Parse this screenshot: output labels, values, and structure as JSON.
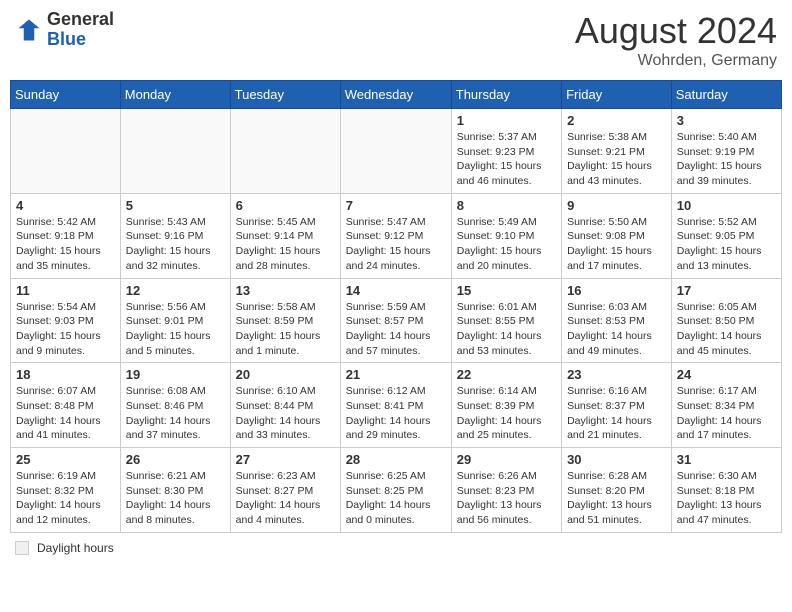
{
  "header": {
    "logo_general": "General",
    "logo_blue": "Blue",
    "month_year": "August 2024",
    "location": "Wohrden, Germany"
  },
  "days_of_week": [
    "Sunday",
    "Monday",
    "Tuesday",
    "Wednesday",
    "Thursday",
    "Friday",
    "Saturday"
  ],
  "legend": {
    "label": "Daylight hours"
  },
  "weeks": [
    [
      {
        "day": "",
        "info": ""
      },
      {
        "day": "",
        "info": ""
      },
      {
        "day": "",
        "info": ""
      },
      {
        "day": "",
        "info": ""
      },
      {
        "day": "1",
        "info": "Sunrise: 5:37 AM\nSunset: 9:23 PM\nDaylight: 15 hours\nand 46 minutes."
      },
      {
        "day": "2",
        "info": "Sunrise: 5:38 AM\nSunset: 9:21 PM\nDaylight: 15 hours\nand 43 minutes."
      },
      {
        "day": "3",
        "info": "Sunrise: 5:40 AM\nSunset: 9:19 PM\nDaylight: 15 hours\nand 39 minutes."
      }
    ],
    [
      {
        "day": "4",
        "info": "Sunrise: 5:42 AM\nSunset: 9:18 PM\nDaylight: 15 hours\nand 35 minutes."
      },
      {
        "day": "5",
        "info": "Sunrise: 5:43 AM\nSunset: 9:16 PM\nDaylight: 15 hours\nand 32 minutes."
      },
      {
        "day": "6",
        "info": "Sunrise: 5:45 AM\nSunset: 9:14 PM\nDaylight: 15 hours\nand 28 minutes."
      },
      {
        "day": "7",
        "info": "Sunrise: 5:47 AM\nSunset: 9:12 PM\nDaylight: 15 hours\nand 24 minutes."
      },
      {
        "day": "8",
        "info": "Sunrise: 5:49 AM\nSunset: 9:10 PM\nDaylight: 15 hours\nand 20 minutes."
      },
      {
        "day": "9",
        "info": "Sunrise: 5:50 AM\nSunset: 9:08 PM\nDaylight: 15 hours\nand 17 minutes."
      },
      {
        "day": "10",
        "info": "Sunrise: 5:52 AM\nSunset: 9:05 PM\nDaylight: 15 hours\nand 13 minutes."
      }
    ],
    [
      {
        "day": "11",
        "info": "Sunrise: 5:54 AM\nSunset: 9:03 PM\nDaylight: 15 hours\nand 9 minutes."
      },
      {
        "day": "12",
        "info": "Sunrise: 5:56 AM\nSunset: 9:01 PM\nDaylight: 15 hours\nand 5 minutes."
      },
      {
        "day": "13",
        "info": "Sunrise: 5:58 AM\nSunset: 8:59 PM\nDaylight: 15 hours\nand 1 minute."
      },
      {
        "day": "14",
        "info": "Sunrise: 5:59 AM\nSunset: 8:57 PM\nDaylight: 14 hours\nand 57 minutes."
      },
      {
        "day": "15",
        "info": "Sunrise: 6:01 AM\nSunset: 8:55 PM\nDaylight: 14 hours\nand 53 minutes."
      },
      {
        "day": "16",
        "info": "Sunrise: 6:03 AM\nSunset: 8:53 PM\nDaylight: 14 hours\nand 49 minutes."
      },
      {
        "day": "17",
        "info": "Sunrise: 6:05 AM\nSunset: 8:50 PM\nDaylight: 14 hours\nand 45 minutes."
      }
    ],
    [
      {
        "day": "18",
        "info": "Sunrise: 6:07 AM\nSunset: 8:48 PM\nDaylight: 14 hours\nand 41 minutes."
      },
      {
        "day": "19",
        "info": "Sunrise: 6:08 AM\nSunset: 8:46 PM\nDaylight: 14 hours\nand 37 minutes."
      },
      {
        "day": "20",
        "info": "Sunrise: 6:10 AM\nSunset: 8:44 PM\nDaylight: 14 hours\nand 33 minutes."
      },
      {
        "day": "21",
        "info": "Sunrise: 6:12 AM\nSunset: 8:41 PM\nDaylight: 14 hours\nand 29 minutes."
      },
      {
        "day": "22",
        "info": "Sunrise: 6:14 AM\nSunset: 8:39 PM\nDaylight: 14 hours\nand 25 minutes."
      },
      {
        "day": "23",
        "info": "Sunrise: 6:16 AM\nSunset: 8:37 PM\nDaylight: 14 hours\nand 21 minutes."
      },
      {
        "day": "24",
        "info": "Sunrise: 6:17 AM\nSunset: 8:34 PM\nDaylight: 14 hours\nand 17 minutes."
      }
    ],
    [
      {
        "day": "25",
        "info": "Sunrise: 6:19 AM\nSunset: 8:32 PM\nDaylight: 14 hours\nand 12 minutes."
      },
      {
        "day": "26",
        "info": "Sunrise: 6:21 AM\nSunset: 8:30 PM\nDaylight: 14 hours\nand 8 minutes."
      },
      {
        "day": "27",
        "info": "Sunrise: 6:23 AM\nSunset: 8:27 PM\nDaylight: 14 hours\nand 4 minutes."
      },
      {
        "day": "28",
        "info": "Sunrise: 6:25 AM\nSunset: 8:25 PM\nDaylight: 14 hours\nand 0 minutes."
      },
      {
        "day": "29",
        "info": "Sunrise: 6:26 AM\nSunset: 8:23 PM\nDaylight: 13 hours\nand 56 minutes."
      },
      {
        "day": "30",
        "info": "Sunrise: 6:28 AM\nSunset: 8:20 PM\nDaylight: 13 hours\nand 51 minutes."
      },
      {
        "day": "31",
        "info": "Sunrise: 6:30 AM\nSunset: 8:18 PM\nDaylight: 13 hours\nand 47 minutes."
      }
    ]
  ]
}
